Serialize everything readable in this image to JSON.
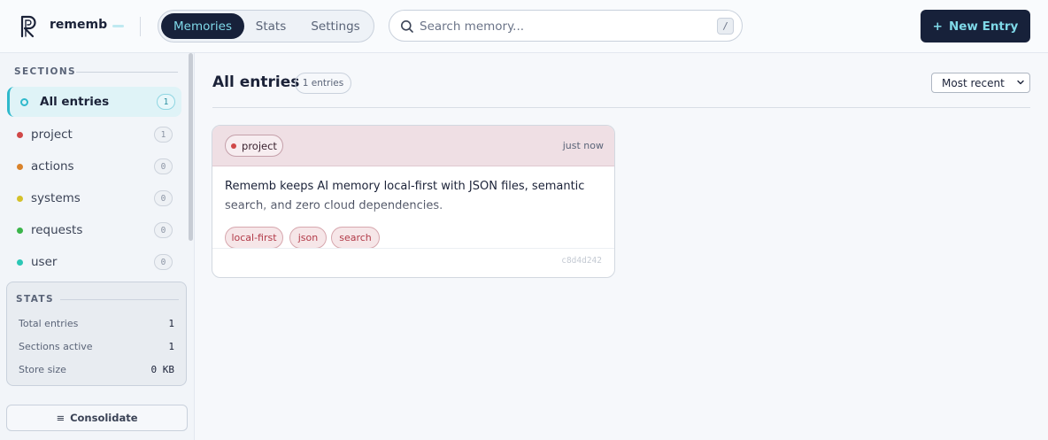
{
  "app": {
    "name": "rememb"
  },
  "nav": {
    "tabs": [
      {
        "label": "Memories",
        "active": true
      },
      {
        "label": "Stats"
      },
      {
        "label": "Settings"
      }
    ]
  },
  "search": {
    "placeholder": "Search memory...",
    "value": "",
    "shortcut": "/"
  },
  "header": {
    "new_entry_label": "+ New Entry",
    "new_entry_text": "New Entry",
    "new_entry_icon": "+"
  },
  "sidebar": {
    "sections_heading": "SECTIONS",
    "items": [
      {
        "label": "All entries",
        "count": "1",
        "color": "#2fb9cc",
        "active": true
      },
      {
        "label": "project",
        "count": "1",
        "color": "#d04848"
      },
      {
        "label": "actions",
        "count": "0",
        "color": "#d9822b"
      },
      {
        "label": "systems",
        "count": "0",
        "color": "#d4c12a"
      },
      {
        "label": "requests",
        "count": "0",
        "color": "#3bb54a"
      },
      {
        "label": "user",
        "count": "0",
        "color": "#2bc7b5"
      }
    ],
    "stats": {
      "heading": "STATS",
      "rows": [
        {
          "label": "Total entries",
          "value": "1"
        },
        {
          "label": "Sections active",
          "value": "1"
        },
        {
          "label": "Store size",
          "value": "0 KB"
        }
      ]
    },
    "consolidate_icon": "≡",
    "consolidate_label": "Consolidate"
  },
  "main": {
    "title": "All entries",
    "count_label": "1 entries",
    "sort": {
      "selected": "Most recent",
      "options": [
        "Most recent"
      ]
    }
  },
  "entries": [
    {
      "section": "project",
      "time": "just now",
      "body": "Rememb keeps AI memory local-first with JSON files, semantic search, and zero cloud dependencies.",
      "tags": [
        "local-first",
        "json",
        "search"
      ],
      "id": "c8d4d242"
    }
  ],
  "colors": {
    "brand_dark": "#17213a",
    "accent": "#2fb9cc",
    "accent_text": "#7fd9e8",
    "project": "#d04848",
    "tag_text": "#b23a48"
  },
  "icons": {
    "logo": "rememb-logo-icon",
    "search": "search-icon",
    "sort": "chevron-down-icon",
    "consolidate": "menu-icon"
  }
}
